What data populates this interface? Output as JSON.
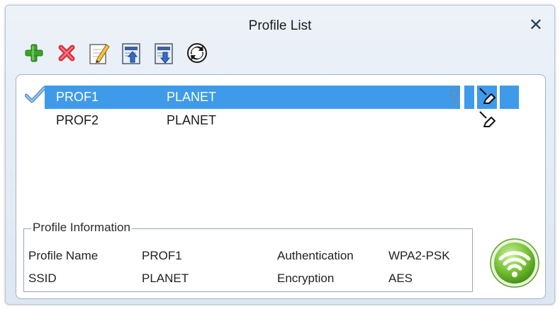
{
  "window": {
    "title": "Profile List",
    "close_glyph": "✕"
  },
  "toolbar": {
    "buttons": [
      {
        "name": "add-profile-button",
        "icon": "plus-icon"
      },
      {
        "name": "delete-profile-button",
        "icon": "x-icon"
      },
      {
        "name": "edit-profile-button",
        "icon": "edit-document-icon"
      },
      {
        "name": "import-profile-button",
        "icon": "import-document-icon"
      },
      {
        "name": "export-profile-button",
        "icon": "export-document-icon"
      },
      {
        "name": "connect-profile-button",
        "icon": "refresh-icon"
      }
    ]
  },
  "profiles": [
    {
      "name": "PROF1",
      "ssid": "PLANET",
      "selected": true,
      "connected": true,
      "secured": true
    },
    {
      "name": "PROF2",
      "ssid": "PLANET",
      "selected": false,
      "connected": false,
      "secured": false
    }
  ],
  "profile_info": {
    "legend": "Profile Information",
    "profile_name_label": "Profile Name",
    "profile_name_value": "PROF1",
    "ssid_label": "SSID",
    "ssid_value": "PLANET",
    "authentication_label": "Authentication",
    "authentication_value": "WPA2-PSK",
    "encryption_label": "Encryption",
    "encryption_value": "AES"
  },
  "colors": {
    "selection": "#3f9aea",
    "wifi_button": "#7cc63a"
  }
}
